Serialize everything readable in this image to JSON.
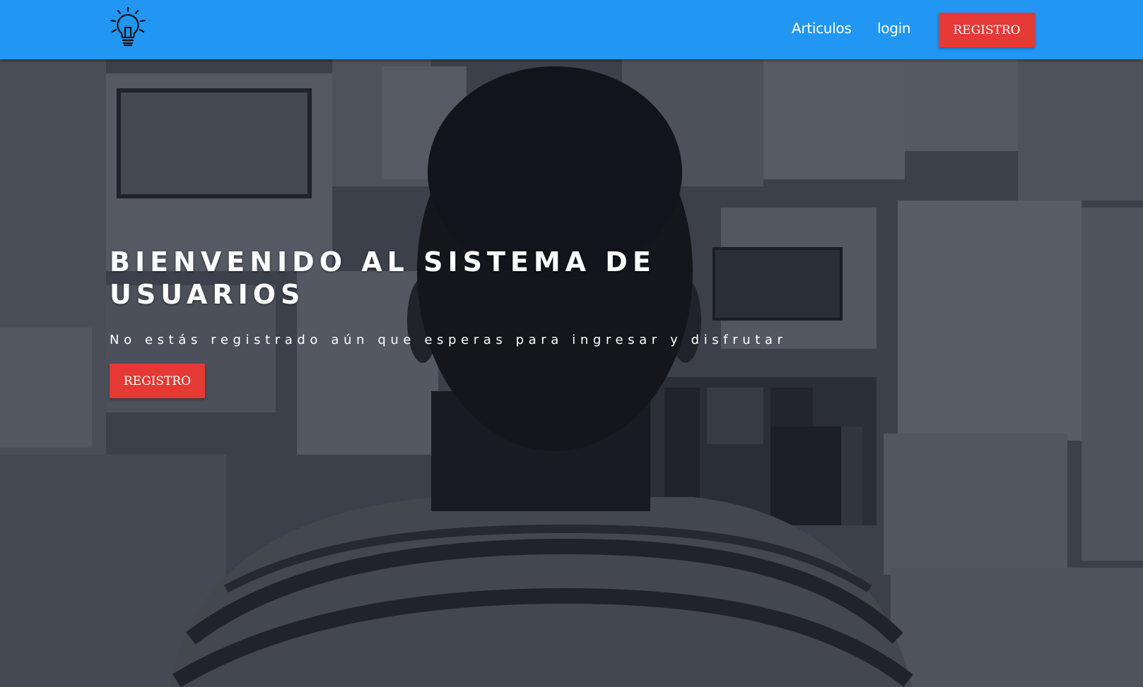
{
  "nav": {
    "logo_icon": "lightbulb-icon",
    "links": [
      {
        "label": "Articulos"
      },
      {
        "label": "login"
      }
    ],
    "register_button": "REGISTRO",
    "bar_color": "#2196f3",
    "button_color": "#e53935"
  },
  "hero": {
    "title": "BIENVENIDO AL SISTEMA DE USUARIOS",
    "subtitle": "No estás registrado aún que esperas para ingresar y disfrutar",
    "button": "REGISTRO"
  }
}
